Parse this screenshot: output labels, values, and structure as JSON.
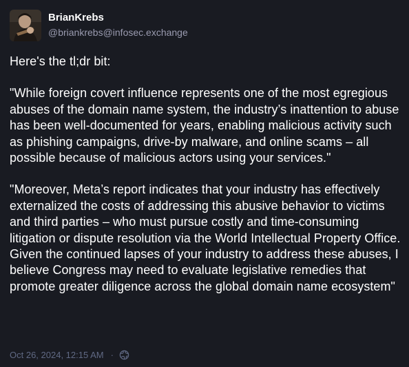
{
  "author": {
    "display_name": "BrianKrebs",
    "handle": "@briankrebs@infosec.exchange",
    "avatar_icon": "profile-photo"
  },
  "post": {
    "paragraphs": [
      "Here's the tl;dr bit:",
      "\"While foreign covert influence represents one of the most egregious abuses of the domain name system, the industry’s inattention to abuse has been well-documented for years, enabling malicious activity such as phishing campaigns, drive-by malware, and online scams – all possible because of malicious actors using your services.\"",
      "\"Moreover, Meta’s report indicates that your industry has effectively externalized the costs of addressing this abusive behavior to victims and third parties – who must pursue costly and time-consuming litigation or dispute resolution via the World Intellectual Property Office.  Given the continued lapses of your industry to address these abuses, I believe Congress may need to evaluate legislative remedies that promote greater diligence across the global domain name ecosystem\""
    ]
  },
  "meta": {
    "timestamp": "Oct 26, 2024, 12:15 AM",
    "separator": "·",
    "visibility_icon": "globe-icon"
  },
  "colors": {
    "background": "#191b22",
    "text": "#ffffff",
    "muted": "#9a9bb0",
    "meta": "#606984"
  }
}
